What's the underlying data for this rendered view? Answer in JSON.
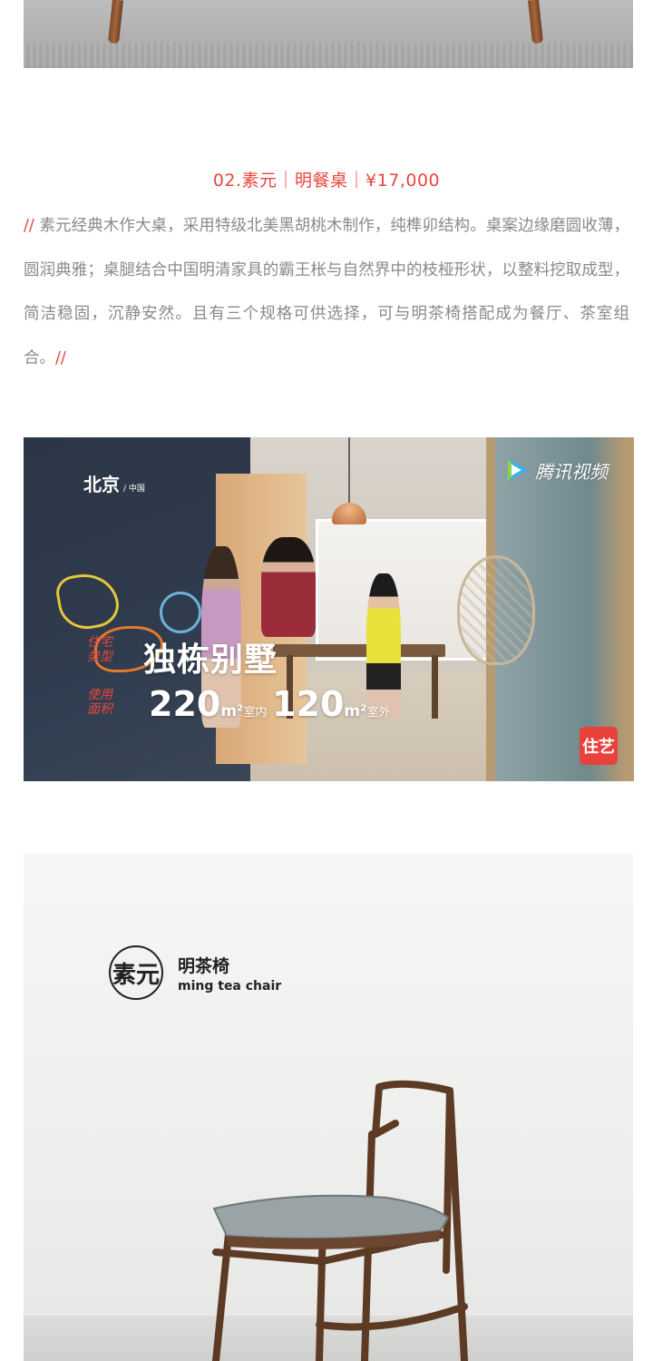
{
  "heading": {
    "text": "02.素元｜明餐桌｜¥17,000"
  },
  "description": {
    "open_mark": "// ",
    "text": "素元经典木作大桌，采用特级北美黑胡桃木制作，纯榫卯结构。桌案边缘磨圆收薄，圆润典雅；桌腿结合中国明清家具的霸王枨与自然界中的枝桠形状，以整料挖取成型，简洁稳固，沉静安然。且有三个规格可供选择，可与明茶椅搭配成为餐厅、茶室组合。",
    "close_mark": "//"
  },
  "video": {
    "city": "北京",
    "country": "/ 中国",
    "watermark": "腾讯视频",
    "label_type": "住宅\n类型",
    "house_type": "独栋别墅",
    "label_area": "使用\n面积",
    "indoor_num": "220",
    "indoor_unit": "m²",
    "indoor_label": "室内",
    "outdoor_num": "120",
    "outdoor_unit": "m²",
    "outdoor_label": "室外",
    "badge": "住艺",
    "accent": "#e8473d"
  },
  "poster": {
    "seal": "素元",
    "title_cn": "明茶椅",
    "title_en": "ming tea chair"
  },
  "colors": {
    "accent": "#e8473d",
    "body_text": "#8a8a8a"
  }
}
